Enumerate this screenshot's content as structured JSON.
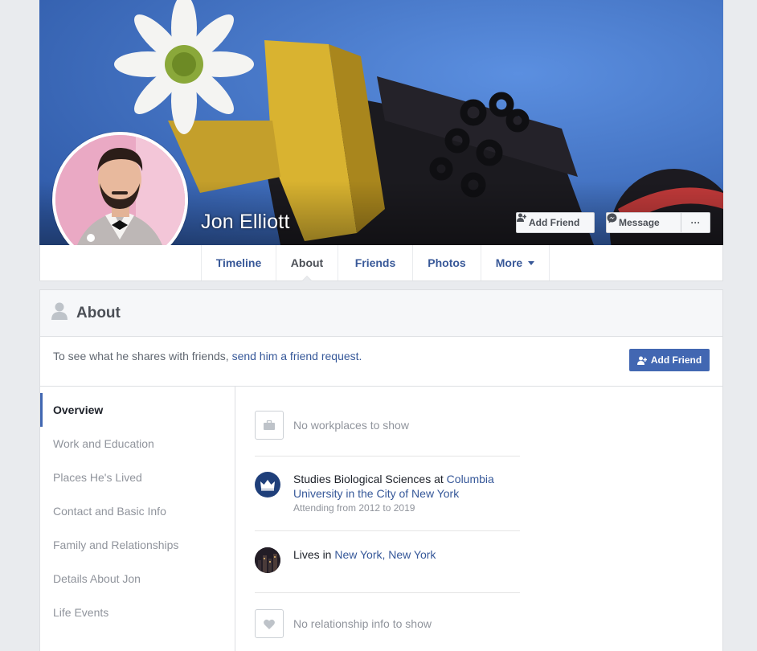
{
  "profile": {
    "name": "Jon Elliott"
  },
  "cover_actions": {
    "add_friend": "Add Friend",
    "message": "Message",
    "more": "···"
  },
  "nav": {
    "tabs": [
      {
        "label": "Timeline"
      },
      {
        "label": "About"
      },
      {
        "label": "Friends"
      },
      {
        "label": "Photos"
      },
      {
        "label": "More"
      }
    ]
  },
  "about": {
    "title": "About",
    "request_text": "To see what he shares with friends, ",
    "request_link": "send him a friend request.",
    "add_friend": "Add Friend",
    "sections": [
      {
        "label": "Overview"
      },
      {
        "label": "Work and Education"
      },
      {
        "label": "Places He's Lived"
      },
      {
        "label": "Contact and Basic Info"
      },
      {
        "label": "Family and Relationships"
      },
      {
        "label": "Details About Jon"
      },
      {
        "label": "Life Events"
      }
    ],
    "overview": {
      "work": "No workplaces to show",
      "education_prefix": "Studies Biological Sciences at ",
      "education_school": "Columbia University in the City of New York",
      "education_sub": "Attending from 2012 to 2019",
      "lives_prefix": "Lives in ",
      "lives_city": "New York, New York",
      "relationship": "No relationship info to show"
    }
  },
  "colors": {
    "brand": "#4267b2",
    "link": "#365899",
    "background": "#e9ebee"
  }
}
